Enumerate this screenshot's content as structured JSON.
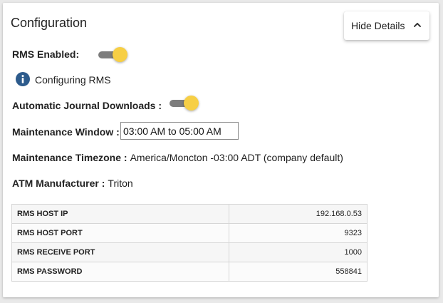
{
  "card": {
    "title": "Configuration",
    "hide_details_label": "Hide Details"
  },
  "rms_enabled": {
    "label": "RMS Enabled:",
    "on": true
  },
  "info": {
    "text": "Configuring RMS",
    "icon": "info-icon"
  },
  "journal_downloads": {
    "label": "Automatic Journal Downloads :",
    "on": true
  },
  "maintenance_window": {
    "label": "Maintenance Window :",
    "value": "03:00 AM to 05:00 AM"
  },
  "maintenance_timezone": {
    "label": "Maintenance Timezone :",
    "value": "America/Moncton -03:00 ADT (company default)"
  },
  "atm_manufacturer": {
    "label": "ATM Manufacturer :",
    "value": "Triton"
  },
  "rms_table": [
    {
      "key": "RMS HOST IP",
      "value": "192.168.0.53"
    },
    {
      "key": "RMS HOST PORT",
      "value": "9323"
    },
    {
      "key": "RMS RECEIVE PORT",
      "value": "1000"
    },
    {
      "key": "RMS PASSWORD",
      "value": "558841"
    }
  ],
  "colors": {
    "toggle_knob": "#f7cf45",
    "toggle_track": "#7d7d7d",
    "info_icon": "#2d5b8c"
  }
}
